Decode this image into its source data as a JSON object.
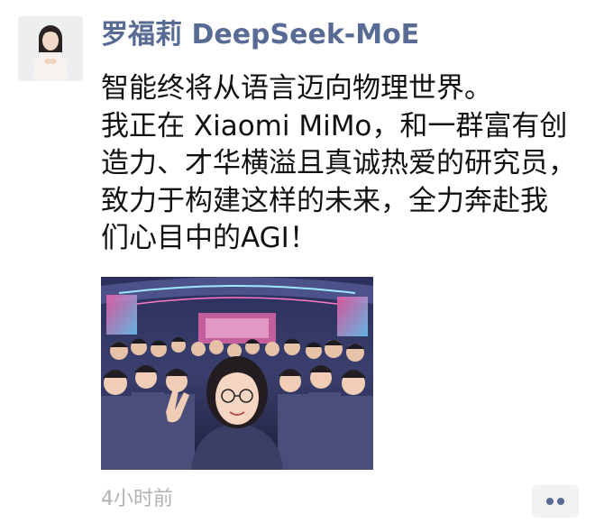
{
  "post": {
    "author": "罗福莉 DeepSeek-MoE",
    "text_lines": [
      "智能终将从语言迈向物理世界。",
      "我正在 Xiaomi MiMo，和一群富有创",
      "造力、才华横溢且真诚热爱的研究员，",
      "致力于构建这样的未来，全力奔赴我",
      "们心目中的AGI！"
    ],
    "timestamp": "4小时前"
  },
  "icons": {
    "avatar": "avatar-portrait",
    "more": "more-dots-icon"
  },
  "colors": {
    "author_name": "#576b95",
    "timestamp": "#b2b2b2",
    "body_text": "#111111",
    "more_button_bg": "#f2f2f2"
  }
}
